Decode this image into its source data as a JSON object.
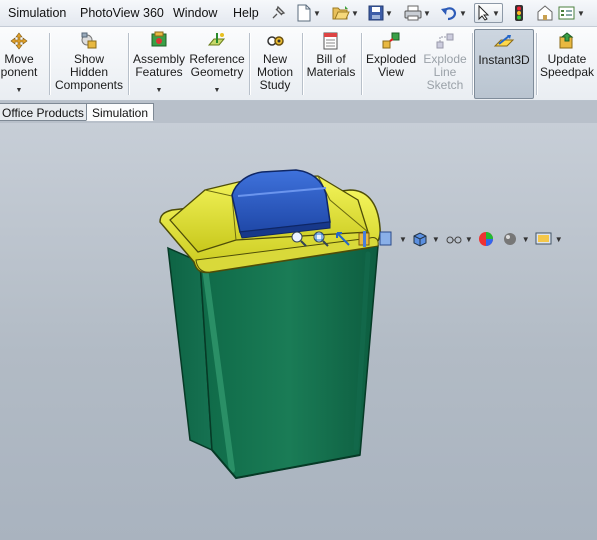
{
  "menu": {
    "items": [
      "Simulation",
      "PhotoView 360",
      "Window",
      "Help"
    ]
  },
  "quick_access": {
    "icons": [
      "pin-icon",
      "new-document-icon",
      "open-folder-icon",
      "save-icon",
      "print-icon",
      "undo-icon",
      "select-pointer-icon",
      "traffic-light-icon",
      "file-properties-icon",
      "options-icon"
    ]
  },
  "ribbon": {
    "buttons": [
      {
        "label": "Move\nponent",
        "icon": "move-component-icon",
        "has_dropdown": true,
        "disabled": false,
        "pressed": false
      },
      {
        "label": "Show\nHidden\nComponents",
        "icon": "show-hidden-icon",
        "has_dropdown": false,
        "disabled": false,
        "pressed": false
      },
      {
        "label": "Assembly\nFeatures",
        "icon": "assembly-features-icon",
        "has_dropdown": true,
        "disabled": false,
        "pressed": false
      },
      {
        "label": "Reference\nGeometry",
        "icon": "reference-geometry-icon",
        "has_dropdown": true,
        "disabled": false,
        "pressed": false
      },
      {
        "label": "New\nMotion\nStudy",
        "icon": "motion-study-icon",
        "has_dropdown": false,
        "disabled": false,
        "pressed": false
      },
      {
        "label": "Bill of\nMaterials",
        "icon": "bill-of-materials-icon",
        "has_dropdown": false,
        "disabled": false,
        "pressed": false
      },
      {
        "label": "Exploded\nView",
        "icon": "exploded-view-icon",
        "has_dropdown": false,
        "disabled": false,
        "pressed": false
      },
      {
        "label": "Explode\nLine\nSketch",
        "icon": "explode-line-sketch-icon",
        "has_dropdown": false,
        "disabled": true,
        "pressed": false
      },
      {
        "label": "Instant3D",
        "icon": "instant3d-icon",
        "has_dropdown": false,
        "disabled": false,
        "pressed": true
      },
      {
        "label": "Update\nSpeedpak",
        "icon": "update-speedpak-icon",
        "has_dropdown": false,
        "disabled": false,
        "pressed": false
      }
    ]
  },
  "tabs": [
    {
      "label": "Office Products",
      "active": false
    },
    {
      "label": "Simulation",
      "active": true
    }
  ],
  "heads_up_toolbar": {
    "icons": [
      "zoom-to-fit-icon",
      "zoom-to-area-icon",
      "previous-view-icon",
      "section-view-icon",
      "view-orientation-icon",
      "display-style-icon",
      "hide-show-items-icon",
      "edit-appearance-icon",
      "apply-scene-icon",
      "view-settings-icon"
    ]
  },
  "model": {
    "name": "trash-bin",
    "body_color": "#1a7a55",
    "lid_color": "#e6e62e",
    "flap_color": "#2f5fc9"
  }
}
